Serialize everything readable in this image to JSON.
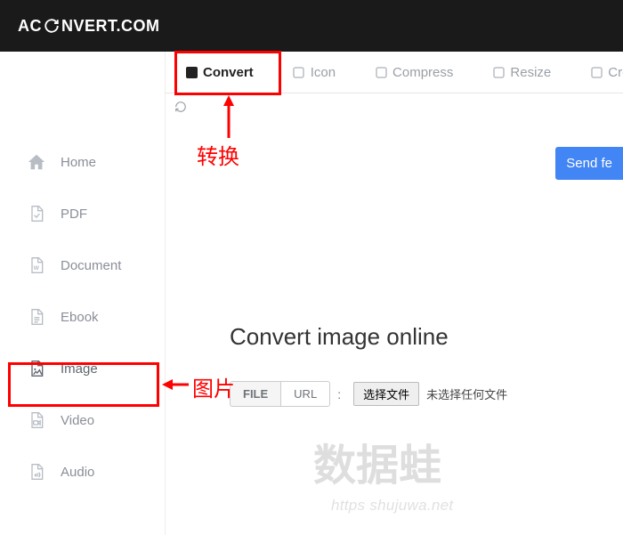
{
  "header": {
    "logo_prefix": "AC",
    "logo_suffix": "NVERT.COM"
  },
  "sidebar": {
    "items": [
      {
        "label": "Home"
      },
      {
        "label": "PDF"
      },
      {
        "label": "Document"
      },
      {
        "label": "Ebook"
      },
      {
        "label": "Image"
      },
      {
        "label": "Video"
      },
      {
        "label": "Audio"
      }
    ]
  },
  "tabs": [
    {
      "label": "Convert",
      "active": true
    },
    {
      "label": "Icon",
      "active": false
    },
    {
      "label": "Compress",
      "active": false
    },
    {
      "label": "Resize",
      "active": false
    },
    {
      "label": "Crop",
      "active": false
    }
  ],
  "send_button": "Send fe",
  "page": {
    "title": "Convert image online",
    "seg_file": "FILE",
    "seg_url": "URL",
    "choose_button": "选择文件",
    "no_file": "未选择任何文件"
  },
  "annotations": {
    "tab_label": "转换",
    "side_label": "图片"
  },
  "watermark": {
    "text": "数据蛙",
    "url": "https shujuwa.net"
  }
}
